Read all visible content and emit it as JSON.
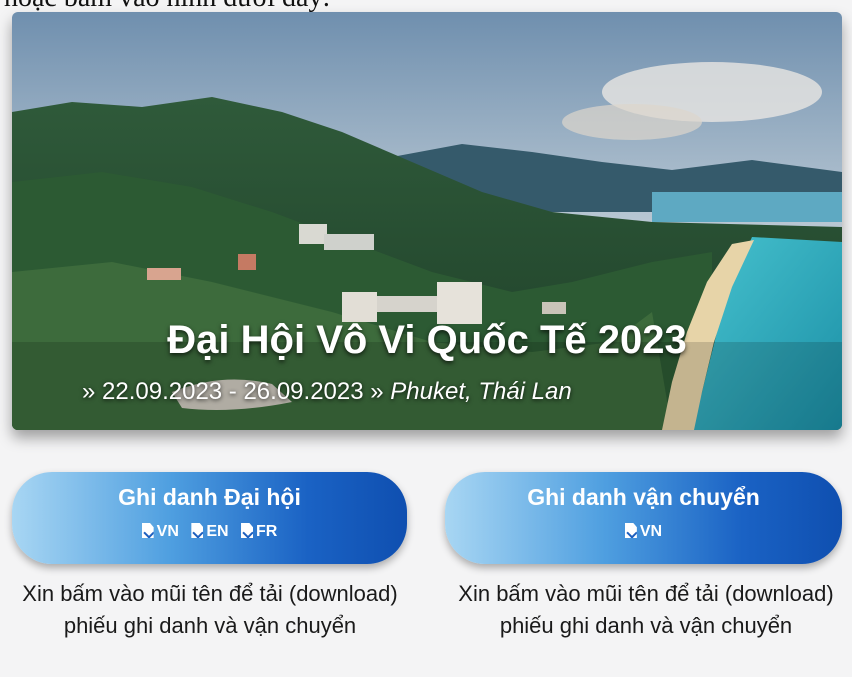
{
  "top_text": "hoặc bấm vào hình dưới đây:",
  "hero": {
    "title": "Đại Hội Vô Vi Quốc Tế 2023",
    "dates": "» 22.09.2023 - 26.09.2023 »",
    "location": "Phuket, Thái Lan"
  },
  "buttons": [
    {
      "title": "Ghi danh Đại hội",
      "links": [
        "VN",
        "EN",
        "FR"
      ]
    },
    {
      "title": "Ghi danh vận chuyển",
      "links": [
        "VN"
      ]
    }
  ],
  "notes": [
    "Xin bấm vào mũi tên để tải (download) phiếu ghi danh và vận chuyển",
    "Xin bấm vào mũi tên để tải (download) phiếu ghi danh và vận chuyển"
  ],
  "icons": {
    "download": "file-download-icon"
  },
  "colors": {
    "button_dark": "#0f4fb0",
    "button_light": "#a8d6f3",
    "sea": "#2fb3c6"
  }
}
